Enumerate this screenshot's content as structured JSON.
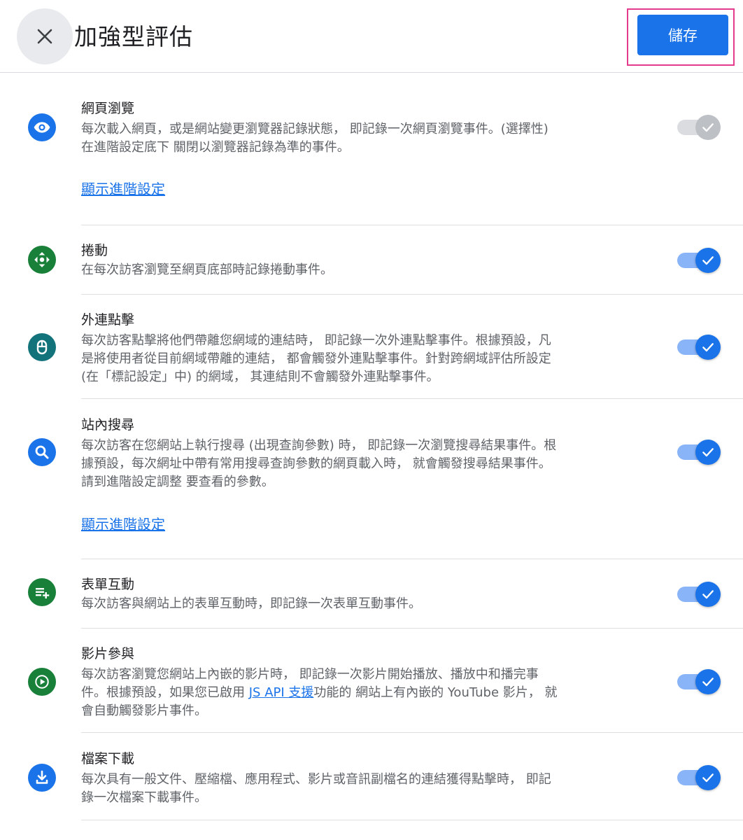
{
  "header": {
    "title": "加強型評估",
    "save_label": "儲存"
  },
  "colors": {
    "accent": "#1a73e8",
    "green": "#188038",
    "teal": "#12737b",
    "highlight": "#e53b8c"
  },
  "sections": [
    {
      "icon": "eye-icon",
      "title": "網頁瀏覽",
      "desc_lines": [
        "每次載入網頁，或是網站變更瀏覽器記錄狀態， 即記錄一次網頁瀏覽事件。(選擇性)",
        "在進階設定底下 關閉以瀏覽器記錄為準的事件。"
      ],
      "advanced_link": "顯示進階設定",
      "enabled": true,
      "disabled": true
    },
    {
      "icon": "scroll-icon",
      "title": "捲動",
      "desc_lines": [
        "在每次訪客瀏覽至網頁底部時記錄捲動事件。"
      ],
      "enabled": true
    },
    {
      "icon": "mouse-icon",
      "title": "外連點擊",
      "desc_lines": [
        "每次訪客點擊將他們帶離您網域的連結時， 即記錄一次外連點擊事件。根據預設，凡",
        "是將使用者從目前網域帶離的連結， 都會觸發外連點擊事件。針對跨網域評估所設定",
        "(在「標記設定」中) 的網域， 其連結則不會觸發外連點擊事件。"
      ],
      "enabled": true
    },
    {
      "icon": "search-icon",
      "title": "站內搜尋",
      "desc_lines": [
        "每次訪客在您網站上執行搜尋 (出現查詢參數) 時， 即記錄一次瀏覽搜尋結果事件。根",
        "據預設，每次網址中帶有常用搜尋查詢參數的網頁載入時， 就會觸發搜尋結果事件。",
        "請到進階設定調整 要查看的參數。"
      ],
      "advanced_link": "顯示進階設定",
      "enabled": true
    },
    {
      "icon": "form-icon",
      "title": "表單互動",
      "desc_lines": [
        "每次訪客與網站上的表單互動時，即記錄一次表單互動事件。"
      ],
      "enabled": true
    },
    {
      "icon": "play-icon",
      "title": "影片參與",
      "desc_lines": [
        "每次訪客瀏覽您網站上內嵌的影片時， 即記錄一次影片開始播放、播放中和播完事"
      ],
      "desc_line2_pre": "件。根據預設，如果您已啟用 ",
      "desc_line2_link": "JS API 支援",
      "desc_line2_post": "功能的 網站上有內嵌的 YouTube 影片， 就",
      "desc_line3": "會自動觸發影片事件。",
      "enabled": true
    },
    {
      "icon": "download-icon",
      "title": "檔案下載",
      "desc_lines": [
        "每次具有一般文件、壓縮檔、應用程式、影片或音訊副檔名的連結獲得點擊時， 即記",
        "錄一次檔案下載事件。"
      ],
      "enabled": true
    }
  ]
}
